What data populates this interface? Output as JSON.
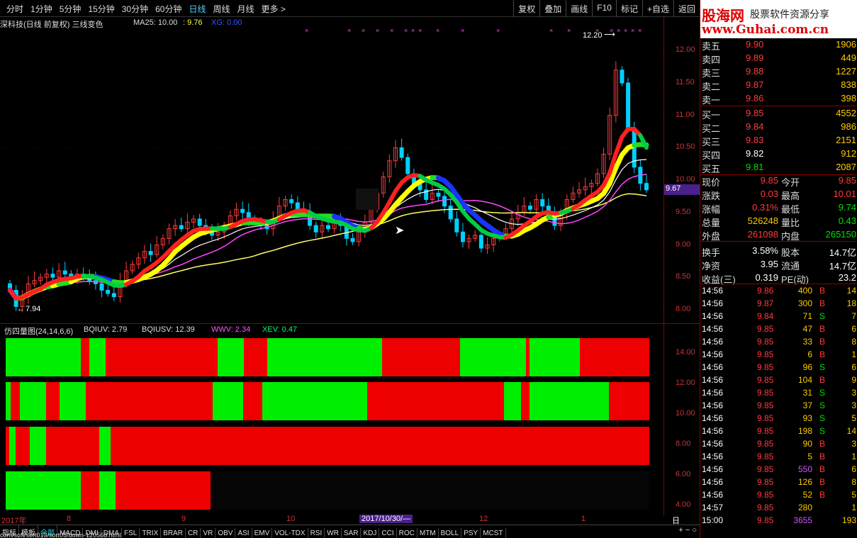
{
  "toolbar": {
    "periods": [
      "分时",
      "1分钟",
      "5分钟",
      "15分钟",
      "30分钟",
      "60分钟",
      "日线",
      "周线",
      "月线",
      "更多 >"
    ],
    "active_period": "日线",
    "buttons": [
      "复权",
      "叠加",
      "画线",
      "F10",
      "标记",
      "+自选",
      "返回"
    ]
  },
  "chart_header": {
    "title": "深科技(日线 前复权) 三线变色",
    "ma25": "MA25: 10.00",
    "ma_extra": ": 9.76",
    "xg": "XG: 0.00"
  },
  "price_axis": {
    "ticks": [
      "12.00",
      "11.50",
      "11.00",
      "10.50",
      "10.00",
      "9.50",
      "9.00",
      "8.50",
      "8.00"
    ],
    "current": "9.67",
    "high_label": "12.20",
    "low_label": "7.94"
  },
  "indicator": {
    "title": "仿四量图(24,14,6,6)",
    "bqiuv": "BQIUV: 2.79",
    "bqiusv": "BQIUSV: 12.39",
    "wwv": "WWV: 2.34",
    "xev": "XEV: 0.47",
    "ticks": [
      "14.00",
      "12.00",
      "10.00",
      "8.00",
      "6.00",
      "4.00"
    ]
  },
  "date_axis": {
    "labels": [
      "2017年",
      "8",
      "9",
      "10",
      "12",
      "1"
    ],
    "cursor": "2017/10/30/—",
    "period": "日线"
  },
  "tabs": [
    "指标",
    "模板",
    "全部",
    "MACD",
    "DMI",
    "DMA",
    "FSL",
    "TRIX",
    "BRAR",
    "CR",
    "VR",
    "OBV",
    "ASI",
    "EMV",
    "VOL-TDX",
    "RSI",
    "WR",
    "SAR",
    "KDJ",
    "CCI",
    "ROC",
    "MTM",
    "BOLL",
    "PSY",
    "MCST"
  ],
  "status_url": "com/soft/sort013/sort05/down-120568.html",
  "banner": {
    "name": "股海网",
    "slogan": "股票软件资源分享",
    "url": "www.Guhai.com.cn"
  },
  "order_book": [
    {
      "label": "卖五",
      "price": "9.90",
      "vol": "1906",
      "color": "red"
    },
    {
      "label": "卖四",
      "price": "9.89",
      "vol": "449",
      "color": "red"
    },
    {
      "label": "卖三",
      "price": "9.88",
      "vol": "1227",
      "color": "red"
    },
    {
      "label": "卖二",
      "price": "9.87",
      "vol": "838",
      "color": "red"
    },
    {
      "label": "卖一",
      "price": "9.86",
      "vol": "398",
      "color": "red"
    },
    {
      "label": "买一",
      "price": "9.85",
      "vol": "4552",
      "color": "red"
    },
    {
      "label": "买二",
      "price": "9.84",
      "vol": "986",
      "color": "red"
    },
    {
      "label": "买三",
      "price": "9.83",
      "vol": "2151",
      "color": "red"
    },
    {
      "label": "买四",
      "price": "9.82",
      "vol": "912",
      "color": "white"
    },
    {
      "label": "买五",
      "price": "9.81",
      "vol": "2087",
      "color": "green"
    }
  ],
  "quote": [
    {
      "k1": "现价",
      "v1": "9.85",
      "c1": "red",
      "k2": "今开",
      "v2": "9.85",
      "c2": "red"
    },
    {
      "k1": "涨跌",
      "v1": "0.03",
      "c1": "red",
      "k2": "最高",
      "v2": "10.01",
      "c2": "red"
    },
    {
      "k1": "涨幅",
      "v1": "0.31%",
      "c1": "red",
      "k2": "最低",
      "v2": "9.74",
      "c2": "green"
    },
    {
      "k1": "总量",
      "v1": "526248",
      "c1": "yellow",
      "k2": "量比",
      "v2": "0.43",
      "c2": "green"
    },
    {
      "k1": "外盘",
      "v1": "261098",
      "c1": "red",
      "k2": "内盘",
      "v2": "265150",
      "c2": "green"
    },
    {
      "k1": "换手",
      "v1": "3.58%",
      "c1": "white",
      "k2": "股本",
      "v2": "14.7亿",
      "c2": "white"
    },
    {
      "k1": "净资",
      "v1": "3.95",
      "c1": "white",
      "k2": "流通",
      "v2": "14.7亿",
      "c2": "white"
    },
    {
      "k1": "收益(三)",
      "v1": "0.319",
      "c1": "white",
      "k2": "PE(动)",
      "v2": "23.2",
      "c2": "white"
    }
  ],
  "ticks": [
    {
      "t": "14:56",
      "p": "9.86",
      "v": "400",
      "s": "B",
      "n": "14"
    },
    {
      "t": "14:56",
      "p": "9.87",
      "v": "300",
      "s": "B",
      "n": "18"
    },
    {
      "t": "14:56",
      "p": "9.84",
      "v": "71",
      "s": "S",
      "n": "7"
    },
    {
      "t": "14:56",
      "p": "9.85",
      "v": "47",
      "s": "B",
      "n": "6"
    },
    {
      "t": "14:56",
      "p": "9.85",
      "v": "33",
      "s": "B",
      "n": "8"
    },
    {
      "t": "14:56",
      "p": "9.85",
      "v": "6",
      "s": "B",
      "n": "1"
    },
    {
      "t": "14:56",
      "p": "9.85",
      "v": "96",
      "s": "S",
      "n": "6"
    },
    {
      "t": "14:56",
      "p": "9.85",
      "v": "104",
      "s": "B",
      "n": "9"
    },
    {
      "t": "14:56",
      "p": "9.85",
      "v": "31",
      "s": "S",
      "n": "3"
    },
    {
      "t": "14:56",
      "p": "9.85",
      "v": "37",
      "s": "S",
      "n": "3"
    },
    {
      "t": "14:56",
      "p": "9.85",
      "v": "93",
      "s": "S",
      "n": "5"
    },
    {
      "t": "14:56",
      "p": "9.85",
      "v": "198",
      "s": "S",
      "n": "14"
    },
    {
      "t": "14:56",
      "p": "9.85",
      "v": "90",
      "s": "B",
      "n": "3"
    },
    {
      "t": "14:56",
      "p": "9.85",
      "v": "5",
      "s": "B",
      "n": "1"
    },
    {
      "t": "14:56",
      "p": "9.85",
      "v": "550",
      "s": "B",
      "n": "6"
    },
    {
      "t": "14:56",
      "p": "9.85",
      "v": "126",
      "s": "B",
      "n": "8"
    },
    {
      "t": "14:56",
      "p": "9.85",
      "v": "52",
      "s": "B",
      "n": "5"
    },
    {
      "t": "14:57",
      "p": "9.85",
      "v": "280",
      "s": "",
      "n": "1"
    },
    {
      "t": "15:00",
      "p": "9.85",
      "v": "3655",
      "s": "",
      "n": "193"
    }
  ],
  "chart_data": {
    "type": "candlestick",
    "ylim": [
      7.9,
      12.3
    ],
    "close": [
      8.3,
      8.05,
      8.2,
      8.4,
      8.45,
      8.5,
      8.55,
      8.5,
      8.6,
      8.55,
      8.5,
      8.55,
      8.5,
      8.45,
      8.4,
      8.3,
      8.25,
      8.2,
      8.45,
      8.6,
      8.7,
      8.8,
      8.9,
      8.85,
      9.0,
      9.1,
      9.25,
      9.3,
      9.25,
      9.35,
      9.4,
      9.3,
      9.2,
      9.15,
      9.2,
      9.3,
      9.45,
      9.55,
      9.5,
      9.4,
      9.35,
      9.3,
      9.25,
      9.4,
      9.6,
      9.7,
      9.65,
      9.55,
      9.5,
      9.3,
      9.2,
      9.3,
      9.25,
      9.35,
      9.3,
      9.1,
      9.05,
      9.2,
      9.35,
      9.55,
      9.8,
      10.05,
      10.3,
      10.5,
      10.35,
      10.1,
      9.95,
      9.85,
      9.7,
      9.8,
      9.75,
      9.6,
      9.4,
      9.2,
      9.05,
      9.1,
      9.15,
      8.95,
      9.0,
      9.1,
      9.15,
      9.25,
      9.4,
      9.5,
      9.6,
      9.55,
      9.7,
      9.6,
      9.45,
      9.3,
      9.5,
      9.7,
      9.8,
      9.85,
      9.9,
      9.95,
      10.1,
      10.4,
      11.0,
      11.7,
      11.5,
      10.8,
      10.2,
      9.95,
      9.85
    ]
  }
}
